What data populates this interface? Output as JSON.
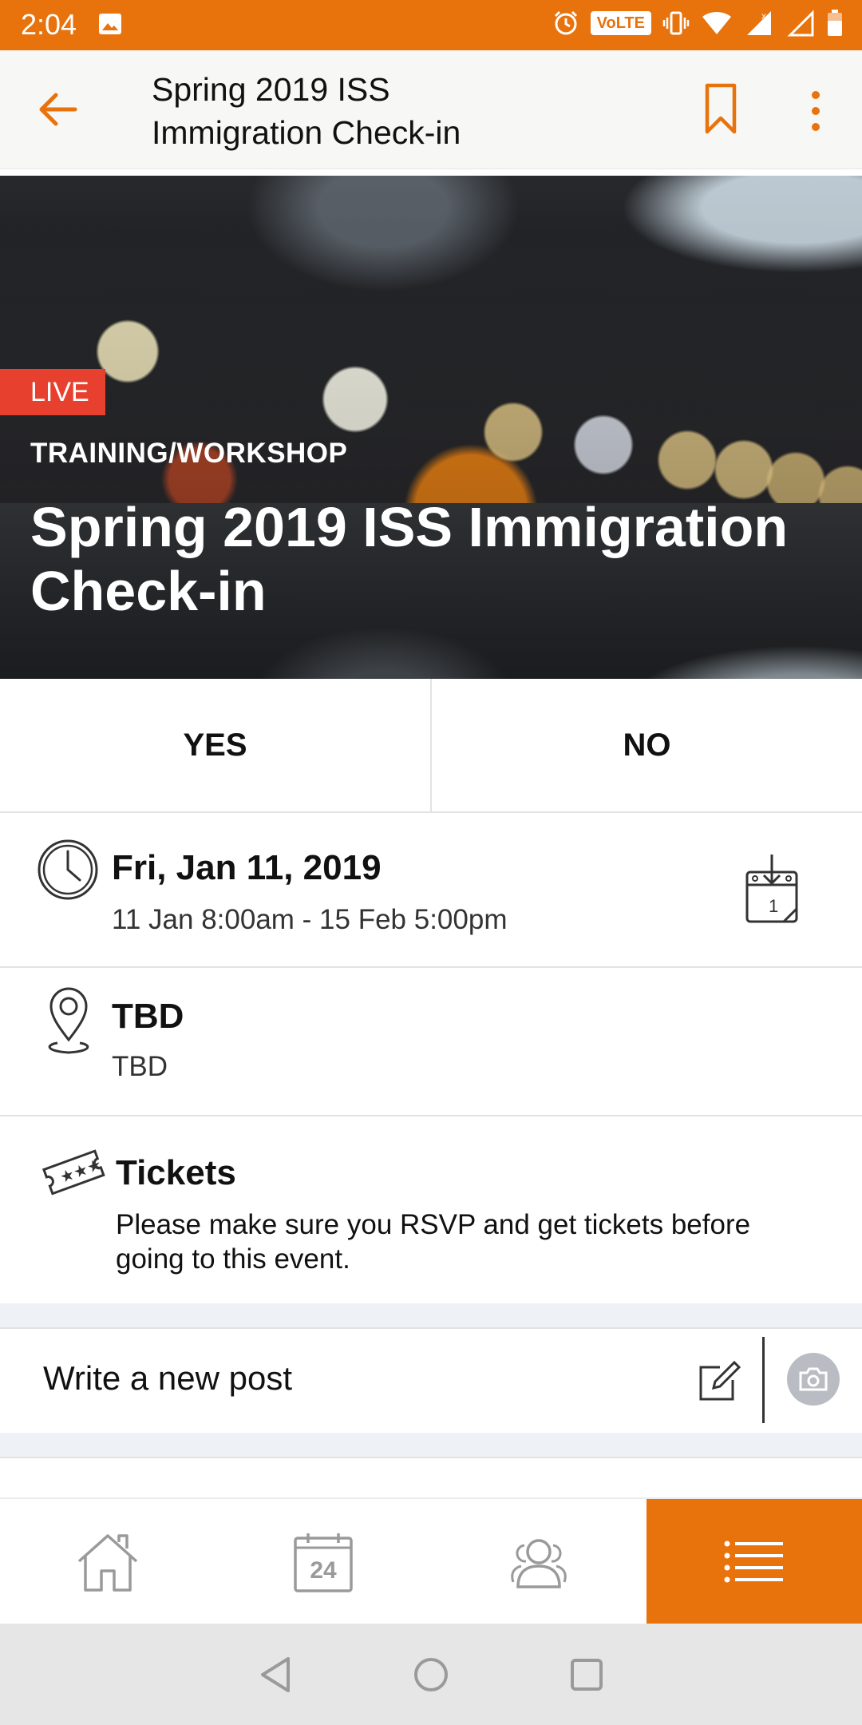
{
  "status_bar": {
    "time": "2:04",
    "volte": "VoLTE",
    "network": "x"
  },
  "app_bar": {
    "title": "Spring 2019 ISS Immigration Check-in"
  },
  "hero": {
    "badge": "LIVE",
    "category": "TRAINING/WORKSHOP",
    "title": "Spring 2019 ISS Immigration Check-in"
  },
  "rsvp": {
    "yes_label": "YES",
    "no_label": "NO"
  },
  "event": {
    "date": "Fri, Jan 11, 2019",
    "time_range": "11 Jan 8:00am - 15 Feb 5:00pm",
    "calendar_day": "1",
    "location_title": "TBD",
    "location_detail": "TBD",
    "tickets_title": "Tickets",
    "tickets_text": "Please make sure you RSVP and get tickets before going to this event."
  },
  "post": {
    "placeholder": "Write a new post"
  },
  "bottom_nav": {
    "calendar_day": "24"
  },
  "colors": {
    "accent": "#e8720c",
    "live_badge": "#e8402e",
    "band": "#eef1f5"
  }
}
